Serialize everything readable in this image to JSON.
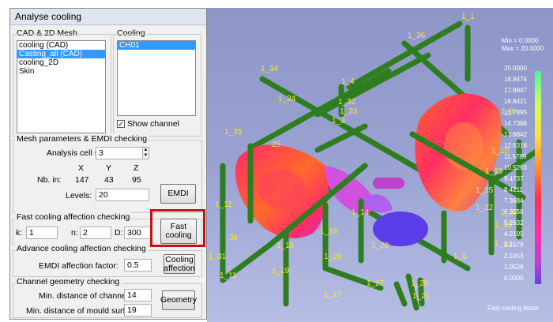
{
  "dialog": {
    "title": "Analyse cooling",
    "cad_group": {
      "label": "CAD & 2D Mesh",
      "items": [
        "cooling (CAD)",
        "Casting_all (CAD)",
        "cooling_2D",
        "Skin"
      ],
      "selected_index": 1
    },
    "cooling_group": {
      "label": "Cooling",
      "items": [
        "CH01"
      ],
      "selected_index": 0,
      "show_channel_label": "Show channel",
      "show_channel_checked": true
    },
    "mesh_group": {
      "label": "Mesh parameters & EMDI checking",
      "analysis_cell_size_label": "Analysis cell size:",
      "analysis_cell_size_value": "3",
      "col_x": "X",
      "col_y": "Y",
      "col_z": "Z",
      "nb_in_label": "Nb. in:",
      "nb_x": "147",
      "nb_y": "43",
      "nb_z": "95",
      "levels_label": "Levels:",
      "levels_value": "20",
      "emdi_button": "EMDI"
    },
    "fast_group": {
      "label": "Fast cooling affection checking",
      "k_label": "k:",
      "k_value": "1",
      "n_label": "n:",
      "n_value": "2",
      "d_label": "D:",
      "d_value": "300",
      "button_line1": "Fast",
      "button_line2": "cooling"
    },
    "advance_group": {
      "label": "Advance cooling affection checking",
      "emdi_factor_label": "EMDI affection factor:",
      "emdi_factor_value": "0.5",
      "button_line1": "Cooling",
      "button_line2": "affection"
    },
    "geometry_group": {
      "label": "Channel geometry checking",
      "min_channel_label": "Min. distance of channel:",
      "min_channel_value": "14",
      "min_mould_label": "Min. distance of mould surface:",
      "min_mould_value": "19",
      "geometry_button": "Geometry"
    }
  },
  "viewport": {
    "min_text": "Min = 0.0000",
    "max_text": "Max = 20.0000",
    "legend_values": [
      "20.0000",
      "18.9474",
      "17.8947",
      "16.8421",
      "15.7895",
      "14.7368",
      "13.6842",
      "12.6316",
      "11.5789",
      "10.5263",
      "9.4737",
      "8.4211",
      "7.3684",
      "6.3158",
      "5.2632",
      "4.2105",
      "3.1579",
      "2.1053",
      "1.0526",
      "0.0000"
    ],
    "legend_title": "Fast cooling factor",
    "channel_labels": [
      "1_1",
      "1_36",
      "1_34",
      "1_4",
      "1_32",
      "1_33",
      "1_3",
      "1_24",
      "1_35",
      "25",
      "1_13",
      "1_10",
      "1_9",
      "1_15",
      "1_22",
      "1_37",
      "1_38",
      "1_23",
      "1_12",
      "1_14",
      "1_16",
      "1_18",
      "1_29",
      "1_28",
      "1_8",
      "1_31",
      "1_11",
      "1_19",
      "1_27",
      "1_17",
      "1_20",
      "1_21",
      "36"
    ],
    "colors": {
      "background_top": "#8e96c8",
      "background_bottom": "#b7bee4",
      "channel": "#2e7d1f",
      "label": "#f4e83a",
      "highlight": "#c0141a"
    }
  }
}
